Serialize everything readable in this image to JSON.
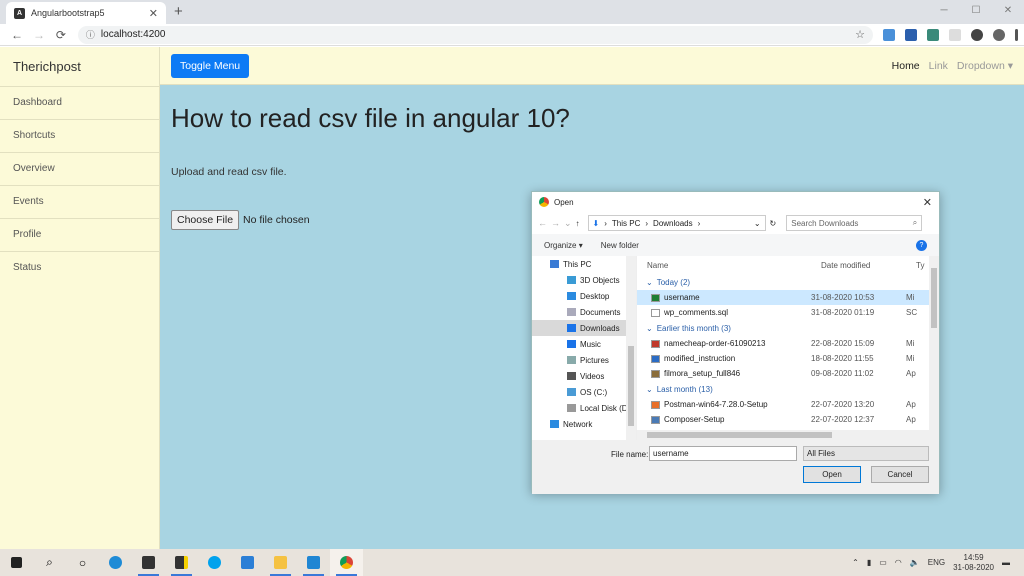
{
  "browser": {
    "tab_title": "Angularbootstrap5",
    "url": "localhost:4200",
    "window_controls": [
      "minimize-icon",
      "maximize-icon",
      "close-icon"
    ]
  },
  "sidebar": {
    "brand": "Therichpost",
    "items": [
      {
        "label": "Dashboard"
      },
      {
        "label": "Shortcuts"
      },
      {
        "label": "Overview"
      },
      {
        "label": "Events"
      },
      {
        "label": "Profile"
      },
      {
        "label": "Status"
      }
    ]
  },
  "topnav": {
    "toggle_label": "Toggle Menu",
    "links": [
      {
        "label": "Home"
      },
      {
        "label": "Link"
      },
      {
        "label": "Dropdown"
      }
    ]
  },
  "page": {
    "title": "How to read csv file in angular 10?",
    "subtitle": "Upload and read csv file.",
    "choose_file_label": "Choose File",
    "file_status": "No file chosen"
  },
  "dialog": {
    "title": "Open",
    "breadcrumb": [
      "This PC",
      "Downloads"
    ],
    "search_placeholder": "Search Downloads",
    "organize": "Organize",
    "new_folder": "New folder",
    "tree": [
      {
        "label": "This PC",
        "root": true
      },
      {
        "label": "3D Objects"
      },
      {
        "label": "Desktop"
      },
      {
        "label": "Documents"
      },
      {
        "label": "Downloads",
        "selected": true
      },
      {
        "label": "Music"
      },
      {
        "label": "Pictures"
      },
      {
        "label": "Videos"
      },
      {
        "label": "OS (C:)"
      },
      {
        "label": "Local Disk (D:)"
      },
      {
        "label": "Network",
        "root": true
      }
    ],
    "columns": {
      "name": "Name",
      "date": "Date modified",
      "type": "Ty"
    },
    "groups": [
      {
        "label": "Today (2)",
        "files": [
          {
            "name": "username",
            "date": "31-08-2020 10:53",
            "type": "Mi",
            "selected": true
          },
          {
            "name": "wp_comments.sql",
            "date": "31-08-2020 01:19",
            "type": "SC"
          }
        ]
      },
      {
        "label": "Earlier this month (3)",
        "files": [
          {
            "name": "namecheap-order-61090213",
            "date": "22-08-2020 15:09",
            "type": "Mi"
          },
          {
            "name": "modified_instruction",
            "date": "18-08-2020 11:55",
            "type": "Mi"
          },
          {
            "name": "filmora_setup_full846",
            "date": "09-08-2020 11:02",
            "type": "Ap"
          }
        ]
      },
      {
        "label": "Last month (13)",
        "files": [
          {
            "name": "Postman-win64-7.28.0-Setup",
            "date": "22-07-2020 13:20",
            "type": "Ap"
          },
          {
            "name": "Composer-Setup",
            "date": "22-07-2020 12:37",
            "type": "Ap"
          }
        ]
      }
    ],
    "file_name_label": "File name:",
    "file_name_value": "username",
    "file_type": "All Files",
    "open_label": "Open",
    "cancel_label": "Cancel"
  },
  "taskbar": {
    "language": "ENG",
    "time": "14:59",
    "date": "31-08-2020"
  }
}
